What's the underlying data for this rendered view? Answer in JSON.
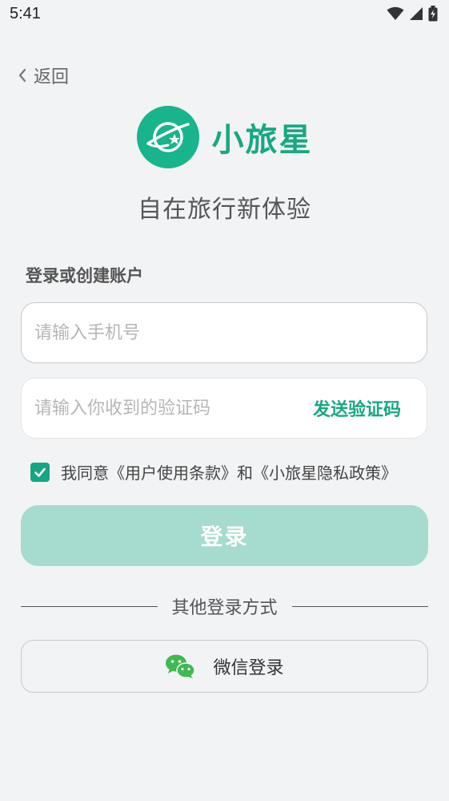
{
  "status_bar": {
    "time": "5:41"
  },
  "nav": {
    "back_label": "返回"
  },
  "brand": {
    "name": "小旅星",
    "tagline": "自在旅行新体验"
  },
  "form": {
    "title": "登录或创建账户",
    "phone_placeholder": "请输入手机号",
    "code_placeholder": "请输入你收到的验证码",
    "send_code_label": "发送验证码",
    "agreement": {
      "checked": true,
      "text": "我同意《用户使用条款》和《小旅星隐私政策》"
    },
    "login_label": "登录"
  },
  "alt_login": {
    "divider_label": "其他登录方式",
    "wechat_label": "微信登录"
  },
  "colors": {
    "brand": "#17a882",
    "login_disabled": "#a6dbcf",
    "wechat": "#3fb950"
  },
  "icons": [
    "wifi-icon",
    "signal-icon",
    "battery-icon",
    "chevron-left-icon",
    "planet-logo-icon",
    "check-icon",
    "wechat-icon"
  ]
}
